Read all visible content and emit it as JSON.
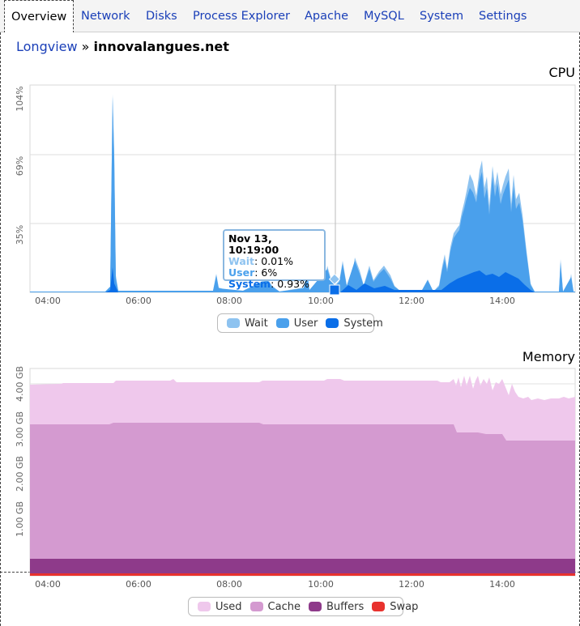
{
  "tabs": [
    {
      "label": "Overview",
      "active": true
    },
    {
      "label": "Network"
    },
    {
      "label": "Disks"
    },
    {
      "label": "Process Explorer"
    },
    {
      "label": "Apache"
    },
    {
      "label": "MySQL"
    },
    {
      "label": "System"
    },
    {
      "label": "Settings"
    }
  ],
  "breadcrumb": {
    "root": "Longview",
    "separator": "»",
    "host": "innovalangues.net"
  },
  "cpu": {
    "title": "CPU",
    "yticks": [
      "104%",
      "69%",
      "35%"
    ],
    "xticks": [
      "04:00",
      "06:00",
      "08:00",
      "10:00",
      "12:00",
      "14:00"
    ],
    "legend": [
      {
        "label": "Wait",
        "color": "#8ec3f0"
      },
      {
        "label": "User",
        "color": "#4aa0ec"
      },
      {
        "label": "System",
        "color": "#0a6ee8"
      }
    ],
    "tooltip": {
      "time": "Nov 13, 10:19:00",
      "rows": [
        {
          "label": "Wait",
          "value": "0.01%",
          "color": "#8ec3f0"
        },
        {
          "label": "User",
          "value": "6%",
          "color": "#4aa0ec"
        },
        {
          "label": "System",
          "value": "0.93%",
          "color": "#0a6ee8"
        }
      ]
    }
  },
  "memory": {
    "title": "Memory",
    "yticks": [
      "4.00 GB",
      "3.00 GB",
      "2.00 GB",
      "1.00 GB"
    ],
    "xticks": [
      "04:00",
      "06:00",
      "08:00",
      "10:00",
      "12:00",
      "14:00"
    ],
    "legend": [
      {
        "label": "Used",
        "color": "#efc8ec"
      },
      {
        "label": "Cache",
        "color": "#d49ad0"
      },
      {
        "label": "Buffers",
        "color": "#8e3a8a"
      },
      {
        "label": "Swap",
        "color": "#e8322e"
      }
    ]
  }
}
